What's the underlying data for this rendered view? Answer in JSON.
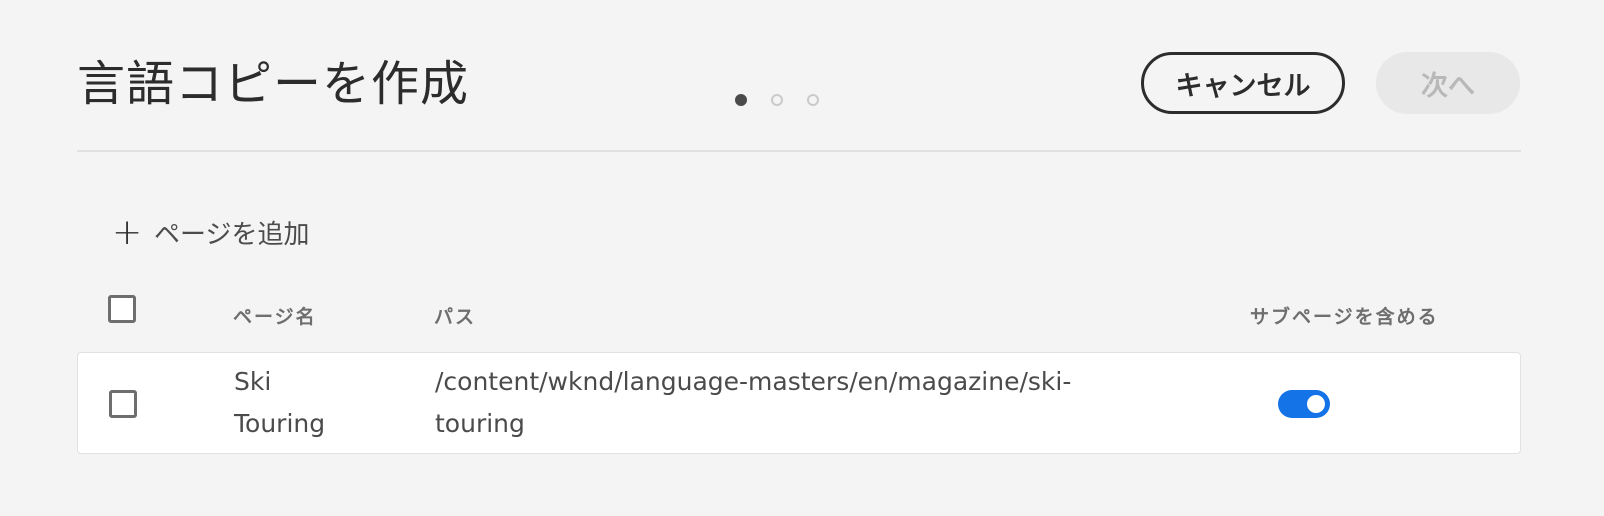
{
  "header": {
    "title": "言語コピーを作成",
    "steps": {
      "current": 1,
      "total": 3
    },
    "cancel_label": "キャンセル",
    "next_label": "次へ"
  },
  "actions": {
    "add_page_label": "ページを追加",
    "add_icon": "plus-icon"
  },
  "table": {
    "columns": {
      "page_name": "ページ名",
      "path": "パス",
      "include_subpages": "サブページを含める"
    },
    "rows": [
      {
        "page_name_line1": "Ski",
        "page_name_line2": "Touring",
        "path_line1": "/content/wknd/language-masters/en/magazine/ski-",
        "path_line2": "touring",
        "include_subpages": true,
        "selected": false
      }
    ]
  },
  "colors": {
    "accent": "#1473e6",
    "background": "#f4f4f4",
    "text": "#2c2c2c"
  }
}
